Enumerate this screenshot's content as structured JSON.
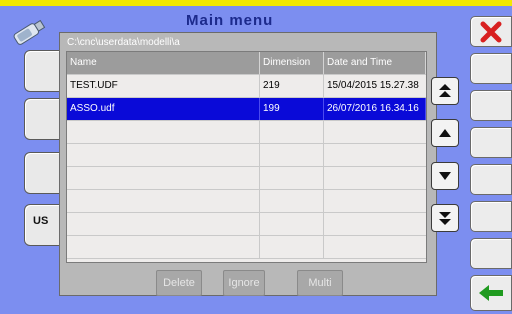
{
  "header": {
    "title": "Main menu"
  },
  "left_menu": {
    "usb_label": "US"
  },
  "dialog": {
    "path": "C:\\cnc\\userdata\\modelli\\a",
    "columns": [
      "Name",
      "Dimension",
      "Date and Time"
    ],
    "rows": [
      {
        "name": "TEST.UDF",
        "dimension": "219",
        "datetime": "15/04/2015 15.27.38",
        "selected": false
      },
      {
        "name": "ASSO.udf",
        "dimension": "199",
        "datetime": "26/07/2016 16.34.16",
        "selected": true
      }
    ],
    "buttons": {
      "delete": "Delete",
      "ignore": "Ignore",
      "multi": "Multi"
    }
  },
  "icons": {
    "close": "close-icon",
    "back": "arrow-left-icon",
    "usb": "usb-stick-icon"
  },
  "colors": {
    "background": "#7c8ef0",
    "selection": "#0a0ad8",
    "top_bar": "#f2e800",
    "close_x": "#d82020",
    "back_arrow": "#1f9a1f"
  }
}
